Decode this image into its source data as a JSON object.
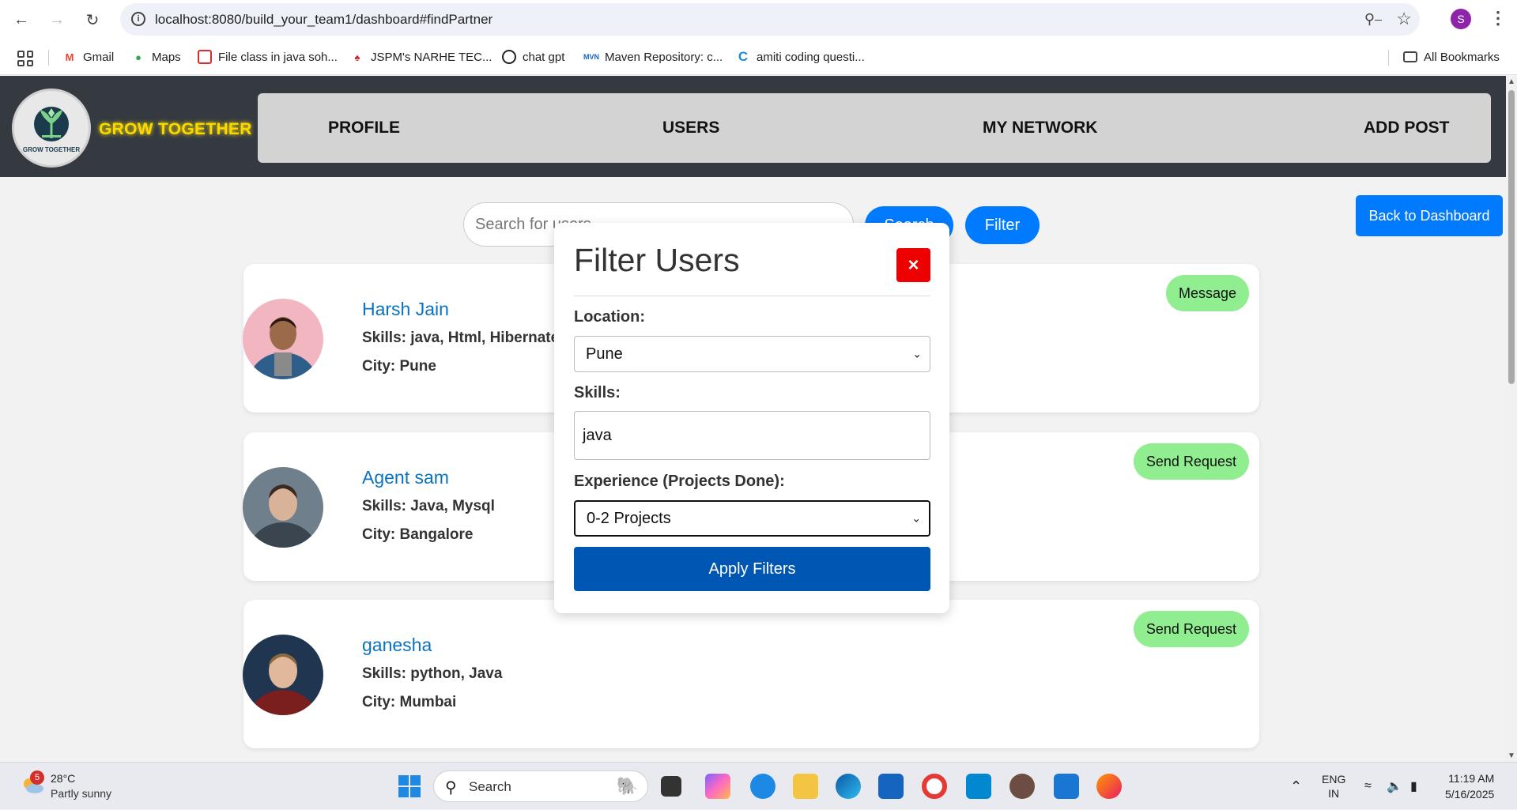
{
  "browser": {
    "url": "localhost:8080/build_your_team1/dashboard#findPartner",
    "profile_initial": "S",
    "bookmarks": [
      {
        "label": "Gmail"
      },
      {
        "label": "Maps"
      },
      {
        "label": "File class in java soh..."
      },
      {
        "label": "JSPM's NARHE TEC..."
      },
      {
        "label": "chat gpt"
      },
      {
        "label": "Maven Repository: c..."
      },
      {
        "label": "amiti coding questi..."
      }
    ],
    "all_bookmarks": "All Bookmarks"
  },
  "header": {
    "logo_text": "GROW TOGETHER",
    "brand": "GROW TOGETHER",
    "nav": [
      "PROFILE",
      "USERS",
      "MY NETWORK",
      "ADD POST"
    ]
  },
  "search": {
    "placeholder": "Search for users",
    "search_label": "Search",
    "filter_label": "Filter",
    "back_label": "Back to Dashboard"
  },
  "users": [
    {
      "name": "Harsh Jain",
      "skills": "Skills: java, Html, Hibernate",
      "city": "City: Pune",
      "action": "Message"
    },
    {
      "name": "Agent sam",
      "skills": "Skills: Java, Mysql",
      "city": "City: Bangalore",
      "action": "Send Request"
    },
    {
      "name": "ganesha",
      "skills": "Skills: python, Java",
      "city": "City: Mumbai",
      "action": "Send Request"
    }
  ],
  "modal": {
    "title": "Filter Users",
    "close": "×",
    "location_label": "Location:",
    "location_value": "Pune",
    "skills_label": "Skills:",
    "skills_value": "java",
    "experience_label": "Experience (Projects Done):",
    "experience_value": "0-2 Projects",
    "apply_label": "Apply Filters"
  },
  "taskbar": {
    "weather_badge": "5",
    "temp": "28°C",
    "condition": "Partly sunny",
    "search": "Search",
    "lang1": "ENG",
    "lang2": "IN",
    "time": "11:19 AM",
    "date": "5/16/2025"
  },
  "colors": {
    "accent": "#007bff",
    "header_bg": "#343a40",
    "brand": "#ffd700",
    "action_green": "#90ee90",
    "close_red": "#ee0000",
    "apply_blue": "#0056b3"
  }
}
